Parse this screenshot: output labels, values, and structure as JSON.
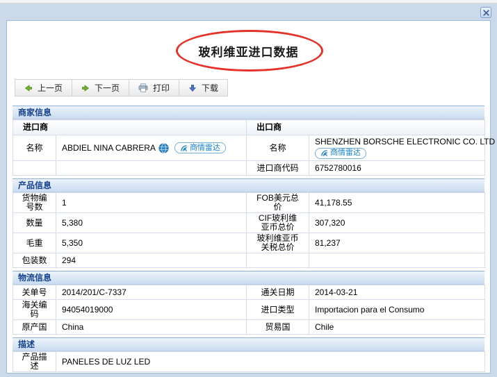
{
  "colors": {
    "section_header_text": "#15428b",
    "badge_blue": "#1a82c8",
    "highlight_circle_red": "#e53229",
    "nav_arrow_green": "#71b32b",
    "download_arrow_blue": "#4a76c5"
  },
  "dialog": {
    "title": "玻利维亚进口数据"
  },
  "toolbar": {
    "prev_label": "上一页",
    "next_label": "下一页",
    "print_label": "打印",
    "download_label": "下载"
  },
  "merchant": {
    "section_title": "商家信息",
    "importer_header": "进口商",
    "exporter_header": "出口商",
    "importer_name_label": "名称",
    "importer_name": "ABDIEL NINA CABRERA",
    "exporter_name_label": "名称",
    "exporter_name": "SHENZHEN BORSCHE ELECTRONIC CO. LTD",
    "radar_badge_label": "商情雷达",
    "importer_code_label": "进口商代码",
    "importer_code": "6752780016"
  },
  "product": {
    "section_title": "产品信息",
    "rows": [
      {
        "l1": "货物编号数",
        "v1": "1",
        "l2": "FOB美元总价",
        "v2": "41,178.55"
      },
      {
        "l1": "数量",
        "v1": "5,380",
        "l2": "CIF玻利维亚币总价",
        "v2": "307,320"
      },
      {
        "l1": "毛重",
        "v1": "5,350",
        "l2": "玻利维亚币关税总价",
        "v2": "81,237"
      },
      {
        "l1": "包装数",
        "v1": "294",
        "l2": "",
        "v2": ""
      }
    ]
  },
  "logistics": {
    "section_title": "物流信息",
    "rows": [
      {
        "l1": "关单号",
        "v1": "2014/201/C-7337",
        "l2": "通关日期",
        "v2": "2014-03-21"
      },
      {
        "l1": "海关编码",
        "v1": "94054019000",
        "l2": "进口类型",
        "v2": "Importacion para el Consumo"
      },
      {
        "l1": "原产国",
        "v1": "China",
        "l2": "贸易国",
        "v2": "Chile"
      }
    ]
  },
  "description": {
    "section_title": "描述",
    "label": "产品描述",
    "value": "PANELES DE LUZ LED"
  }
}
